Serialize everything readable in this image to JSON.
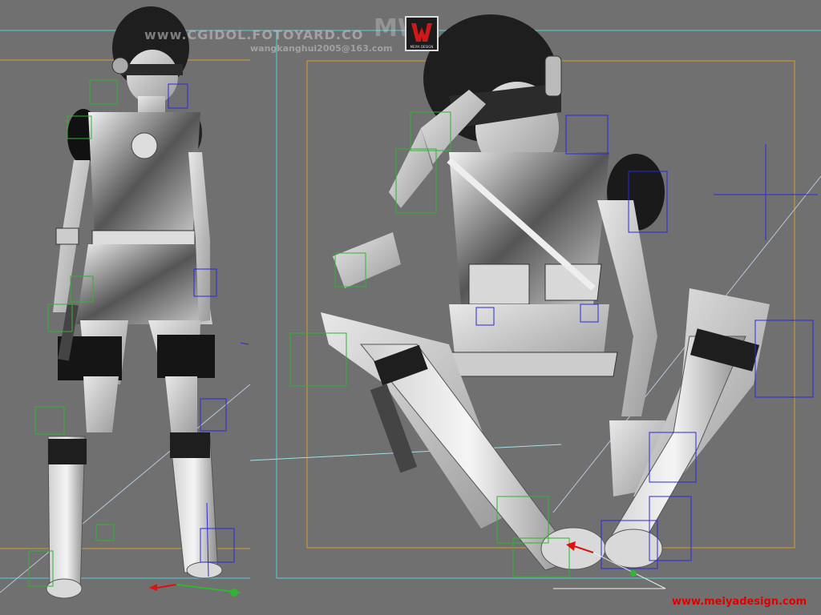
{
  "watermarks": {
    "site_top": "www.CGIDOL.FOTOYARD.CO",
    "email": "wangkanghui2005@163.com",
    "logo_text": "MW",
    "logo_small": "MEIYA DESIGN",
    "site_bottom": "www.meiyadesign.com"
  },
  "colors": {
    "viewport_bg": "#707070",
    "safe_frame_orange": "#d89a2a",
    "frame_cyan": "#4fd0dd",
    "bone_green": "#2fb52f",
    "bone_blue": "#2a2ae0",
    "gizmo_red": "#e01010",
    "watermark_red": "#e00000"
  },
  "viewports": [
    {
      "name": "left",
      "content": "standing character with rig"
    },
    {
      "name": "right",
      "content": "seated character with rig"
    }
  ]
}
